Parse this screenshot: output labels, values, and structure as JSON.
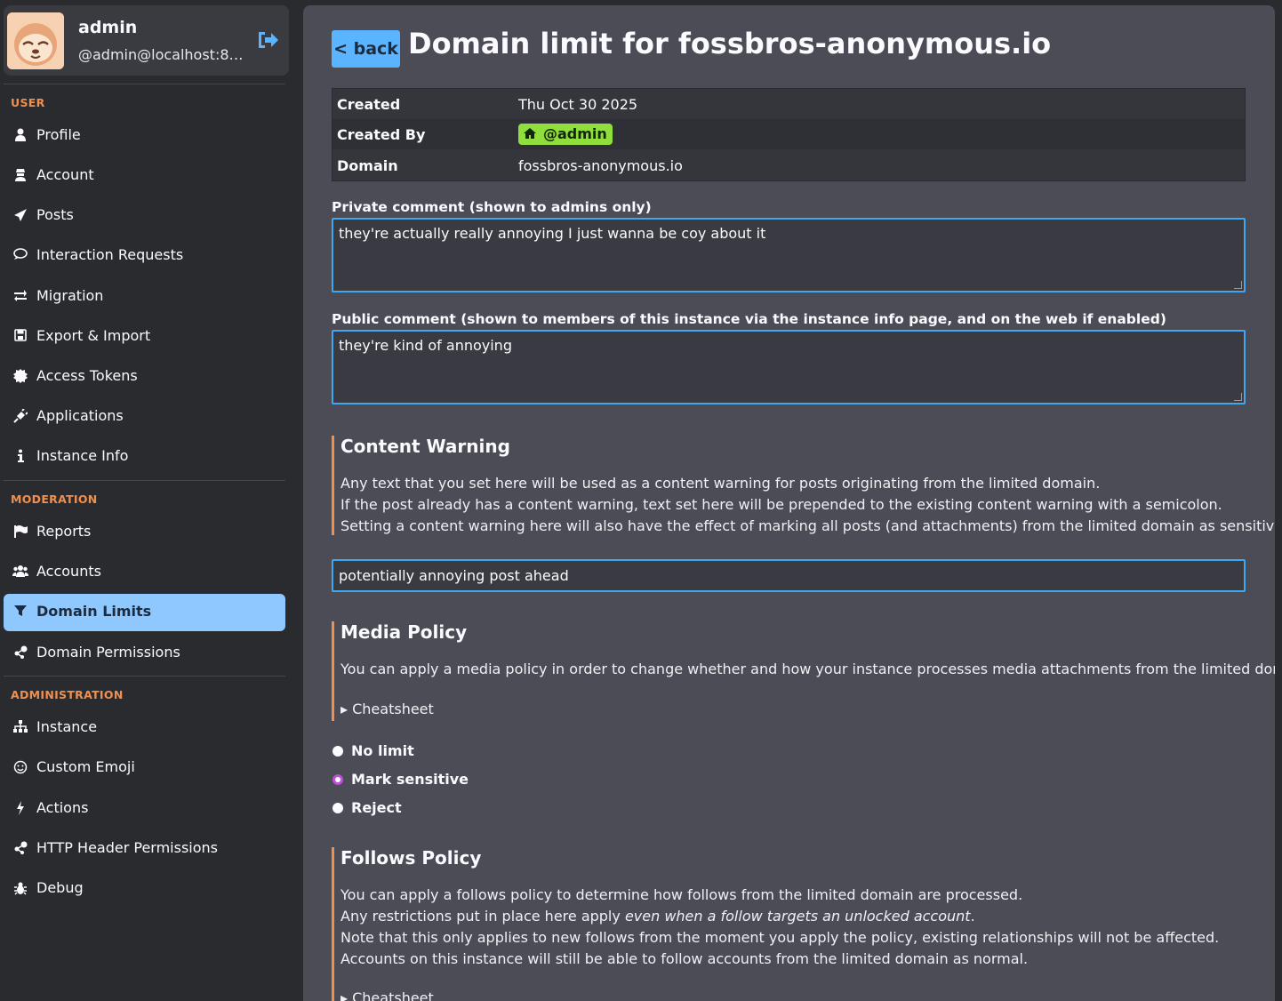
{
  "user": {
    "name": "admin",
    "handle": "@admin@localhost:80..."
  },
  "sidebar": {
    "sections": {
      "user": "USER",
      "moderation": "MODERATION",
      "administration": "ADMINISTRATION"
    },
    "user_items": [
      {
        "label": "Profile",
        "icon": "user-icon"
      },
      {
        "label": "Account",
        "icon": "user-secret-icon"
      },
      {
        "label": "Posts",
        "icon": "paper-plane-icon"
      },
      {
        "label": "Interaction Requests",
        "icon": "speech-bubble-icon"
      },
      {
        "label": "Migration",
        "icon": "exchange-icon"
      },
      {
        "label": "Export & Import",
        "icon": "floppy-disk-icon"
      },
      {
        "label": "Access Tokens",
        "icon": "certificate-icon"
      },
      {
        "label": "Applications",
        "icon": "plug-icon"
      },
      {
        "label": "Instance Info",
        "icon": "info-icon"
      }
    ],
    "moderation_items": [
      {
        "label": "Reports",
        "icon": "flag-icon"
      },
      {
        "label": "Accounts",
        "icon": "users-icon"
      },
      {
        "label": "Domain Limits",
        "icon": "filter-icon",
        "active": true
      },
      {
        "label": "Domain Permissions",
        "icon": "nodes-icon"
      }
    ],
    "administration_items": [
      {
        "label": "Instance",
        "icon": "sitemap-icon"
      },
      {
        "label": "Custom Emoji",
        "icon": "smiley-icon"
      },
      {
        "label": "Actions",
        "icon": "bolt-icon"
      },
      {
        "label": "HTTP Header Permissions",
        "icon": "nodes-icon"
      },
      {
        "label": "Debug",
        "icon": "bug-icon"
      }
    ]
  },
  "main": {
    "back_label": "< back",
    "title": "Domain limit for fossbros-anonymous.io",
    "info": {
      "created_key": "Created",
      "created_val": "Thu Oct 30 2025",
      "created_by_key": "Created By",
      "created_by_val": "@admin",
      "domain_key": "Domain",
      "domain_val": "fossbros-anonymous.io"
    },
    "private_comment": {
      "label": "Private comment (shown to admins only)",
      "value": "they're actually really annoying I just wanna be coy about it"
    },
    "public_comment": {
      "label": "Public comment (shown to members of this instance via the instance info page, and on the web if enabled)",
      "value": "they're kind of annoying"
    },
    "content_warning": {
      "heading": "Content Warning",
      "line1": "Any text that you set here will be used as a content warning for posts originating from the limited domain.",
      "line2": "If the post already has a content warning, text set here will be prepended to the existing content warning with a semicolon.",
      "line3": "Setting a content warning here will also have the effect of marking all posts (and attachments) from the limited domain as sensitive.",
      "value": "potentially annoying post ahead"
    },
    "media_policy": {
      "heading": "Media Policy",
      "desc": "You can apply a media policy in order to change whether and how your instance processes media attachments from the limited domain.",
      "cheatsheet": "▸ Cheatsheet",
      "options": [
        "No limit",
        "Mark sensitive",
        "Reject"
      ],
      "selected": "Mark sensitive"
    },
    "follows_policy": {
      "heading": "Follows Policy",
      "line1": "You can apply a follows policy to determine how follows from the limited domain are processed.",
      "line2_pre": "Any restrictions put in place here apply ",
      "line2_em": "even when a follow targets an unlocked account",
      "line2_post": ".",
      "line3": "Note that this only applies to new follows from the moment you apply the policy, existing relationships will not be affected.",
      "line4": "Accounts on this instance will still be able to follow accounts from the limited domain as normal.",
      "cheatsheet": "▸ Cheatsheet"
    }
  },
  "colors": {
    "accent": "#f28f4d",
    "active_nav": "#8fc8ff",
    "back_button": "#5bb4ff",
    "badge": "#8fde3c",
    "input_border": "#45a6f0",
    "radio_selected": "#c04fd6"
  }
}
